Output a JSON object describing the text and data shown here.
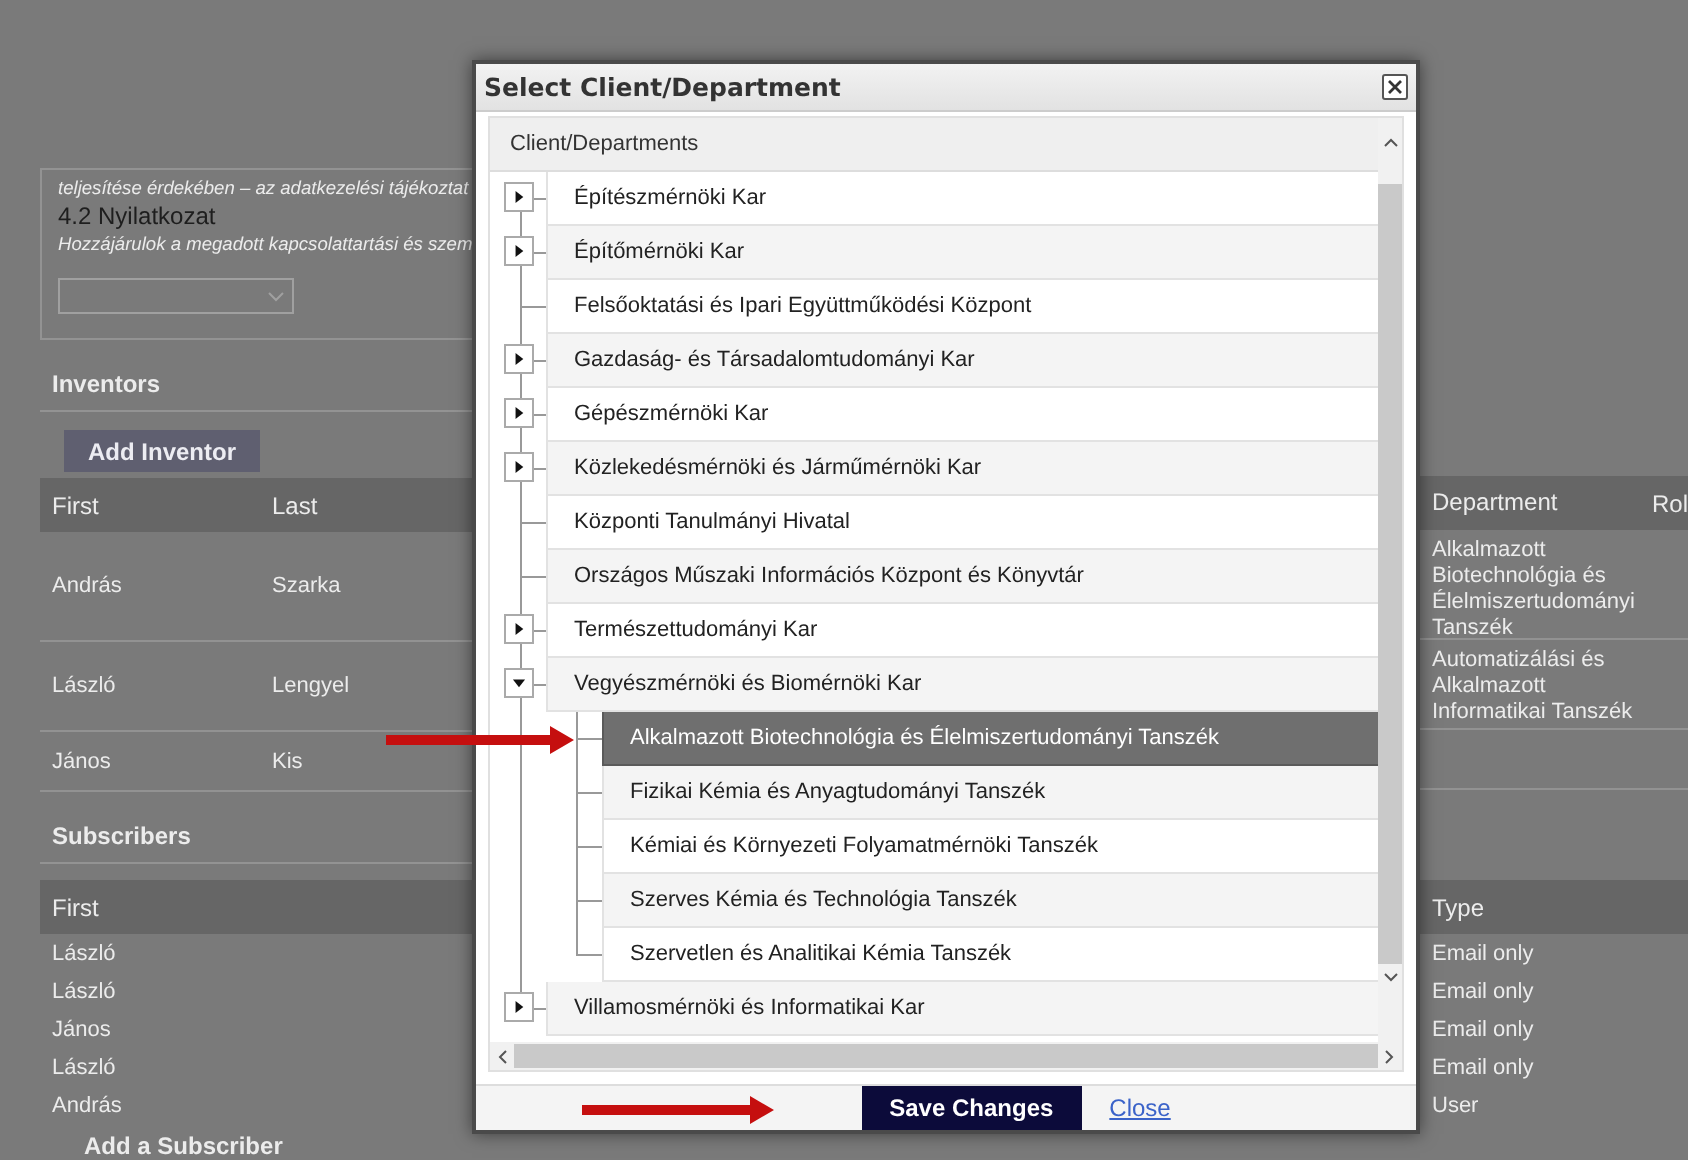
{
  "background": {
    "consent": {
      "note": "teljesítése érdekében – az adatkezelési tájékoztat",
      "heading": "4.2 Nyilatkozat",
      "statement": "Hozzájárulok a megadott kapcsolattartási és szem"
    },
    "inventors": {
      "title": "Inventors",
      "add_button": "Add Inventor",
      "columns_left": [
        "First",
        "Last"
      ],
      "columns_right": [
        "Department",
        "Rol"
      ],
      "rows": [
        {
          "first": "András",
          "last": "Szarka",
          "department": "Alkalmazott Biotechnológia és Élelmiszertudományi Tanszék"
        },
        {
          "first": "László",
          "last": "Lengyel",
          "department": "Automatizálási és Alkalmazott Informatikai Tanszék"
        },
        {
          "first": "János",
          "last": "Kis"
        }
      ]
    },
    "subscribers": {
      "title": "Subscribers",
      "column_left": "First",
      "column_right": "Type",
      "rows": [
        {
          "first": "László",
          "type": "Email only"
        },
        {
          "first": "László",
          "type": "Email only"
        },
        {
          "first": "János",
          "type": "Email only"
        },
        {
          "first": "László",
          "type": "Email only"
        },
        {
          "first": "András",
          "type": "User"
        }
      ],
      "add_link": "Add a Subscriber"
    }
  },
  "dialog": {
    "title": "Select Client/Department",
    "tree": {
      "header": "Client/Departments",
      "items": [
        {
          "label": "Építészmérnöki Kar",
          "kind": "group",
          "expanded": false,
          "selected": false
        },
        {
          "label": "Építőmérnöki Kar",
          "kind": "group",
          "expanded": false,
          "selected": false
        },
        {
          "label": "Felsőoktatási és Ipari Együttműködési Központ",
          "kind": "leaf",
          "selected": false
        },
        {
          "label": "Gazdaság- és Társadalomtudományi Kar",
          "kind": "group",
          "expanded": false,
          "selected": false
        },
        {
          "label": "Gépészmérnöki Kar",
          "kind": "group",
          "expanded": false,
          "selected": false
        },
        {
          "label": "Közlekedésmérnöki és Járműmérnöki Kar",
          "kind": "group",
          "expanded": false,
          "selected": false
        },
        {
          "label": "Központi Tanulmányi Hivatal",
          "kind": "leaf",
          "selected": false
        },
        {
          "label": "Országos Műszaki Információs Központ és Könyvtár",
          "kind": "leaf",
          "selected": false
        },
        {
          "label": "Természettudományi Kar",
          "kind": "group",
          "expanded": false,
          "selected": false
        },
        {
          "label": "Vegyészmérnöki és Biomérnöki Kar",
          "kind": "group",
          "expanded": true,
          "selected": false,
          "children": [
            {
              "label": "Alkalmazott Biotechnológia és Élelmiszertudományi Tanszék",
              "kind": "leaf",
              "selected": true
            },
            {
              "label": "Fizikai Kémia és Anyagtudományi Tanszék",
              "kind": "leaf",
              "selected": false
            },
            {
              "label": "Kémiai és Környezeti Folyamatmérnöki Tanszék",
              "kind": "leaf",
              "selected": false
            },
            {
              "label": "Szerves Kémia és Technológia Tanszék",
              "kind": "leaf",
              "selected": false
            },
            {
              "label": "Szervetlen és Analitikai Kémia Tanszék",
              "kind": "leaf",
              "selected": false
            }
          ]
        },
        {
          "label": "Villamosmérnöki és Informatikai Kar",
          "kind": "group",
          "expanded": false,
          "selected": false
        }
      ]
    },
    "save_button": "Save Changes",
    "close_link": "Close"
  }
}
